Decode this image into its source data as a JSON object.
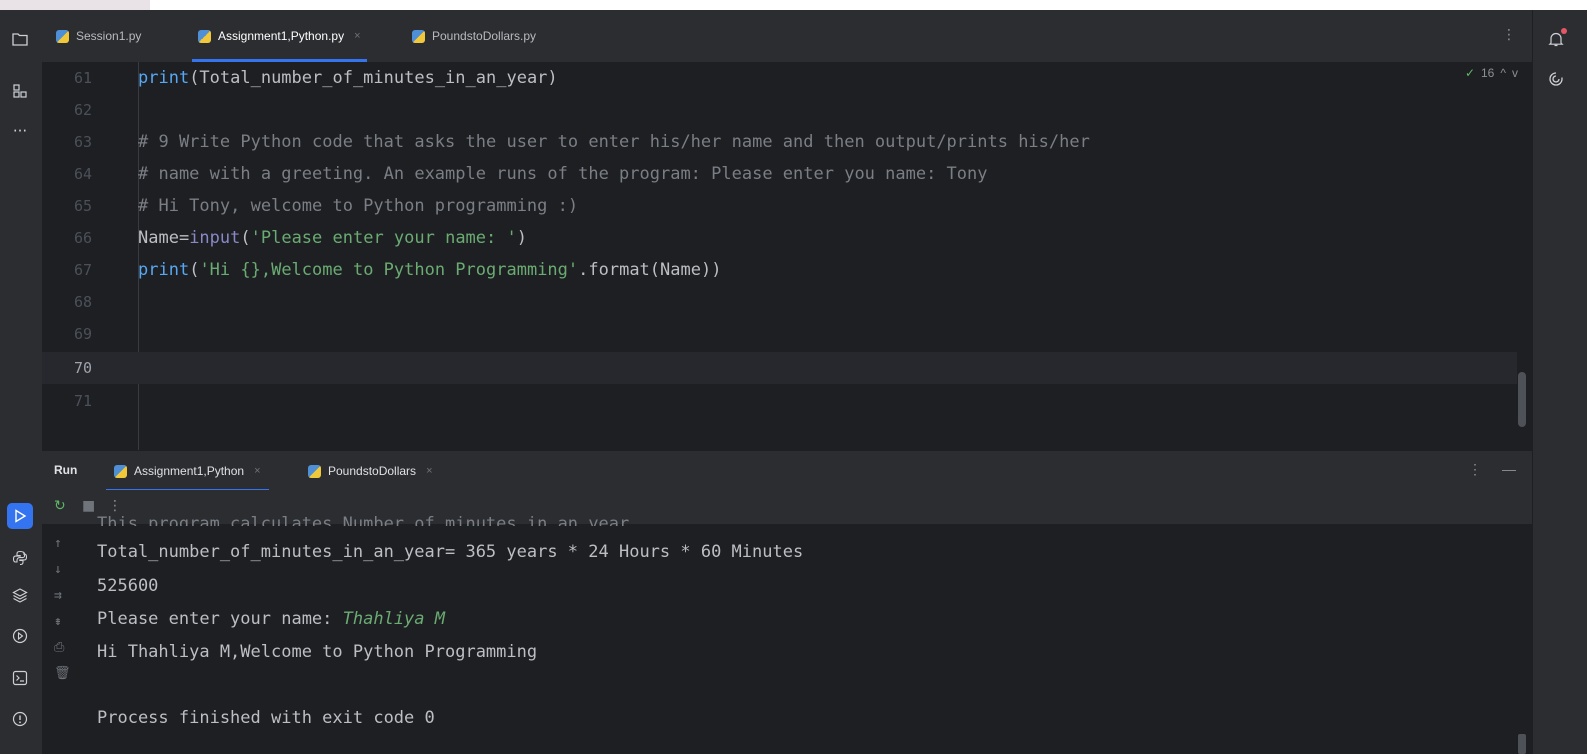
{
  "editor_tabs": [
    {
      "label": "Session1.py",
      "active": false,
      "closable": false
    },
    {
      "label": "Assignment1,Python.py",
      "active": true,
      "closable": true
    },
    {
      "label": "PoundstoDollars.py",
      "active": false,
      "closable": false
    }
  ],
  "tab_close_glyph": "×",
  "more_glyph": "⋮",
  "left_toolbar_icons": [
    "project-icon",
    "structure-icon",
    "more-icon"
  ],
  "left_bottom_icons": [
    "run-icon",
    "python-packages-icon",
    "layers-icon",
    "services-icon",
    "terminal-icon",
    "problems-icon"
  ],
  "right_toolbar_icons": [
    "notifications-icon",
    "ai-assistant-icon"
  ],
  "inspection": {
    "count": "16",
    "up": "^",
    "down": "v"
  },
  "editor": {
    "lines": [
      {
        "num": "61",
        "code": "print(Total_number_of_minutes_in_an_year)"
      },
      {
        "num": "62",
        "code": ""
      },
      {
        "num": "63",
        "code": "# 9 Write Python code that asks the user to enter his/her name and then output/prints his/her"
      },
      {
        "num": "64",
        "code": "# name with a greeting. An example runs of the program: Please enter you name: Tony"
      },
      {
        "num": "65",
        "code": "# Hi Tony, welcome to Python programming :)"
      },
      {
        "num": "66",
        "code": "Name=input('Please enter your name: ')"
      },
      {
        "num": "67",
        "code": "print('Hi {},Welcome to Python Programming'.format(Name))"
      },
      {
        "num": "68",
        "code": ""
      },
      {
        "num": "69",
        "code": ""
      },
      {
        "num": "70",
        "code": "",
        "current": true
      },
      {
        "num": "71",
        "code": ""
      }
    ],
    "tokens": {
      "l61_fn": "print",
      "l61_rest": "(Total_number_of_minutes_in_an_year)",
      "l66_var": "Name=",
      "l66_fn": "input",
      "l66_open": "(",
      "l66_str": "'Please enter your name: '",
      "l66_close": ")",
      "l67_fn": "print",
      "l67_open": "(",
      "l67_str": "'Hi {},Welcome to Python Programming'",
      "l67_rest": ".format(Name))"
    }
  },
  "run_panel": {
    "label": "Run",
    "tabs": [
      {
        "label": "Assignment1,Python",
        "active": true
      },
      {
        "label": "PoundstoDollars",
        "active": false
      }
    ],
    "controls": {
      "more": "⋮",
      "minimize": "—"
    },
    "toolbar": {
      "rerun": "↻",
      "stop": "■",
      "more": "⋮"
    }
  },
  "console": {
    "partial_line": "This_program_calculates_Number_of_minutes_in_an_year",
    "lines": [
      "Total_number_of_minutes_in_an_year= 365 years * 24 Hours * 60 Minutes",
      "525600",
      "Please enter your name: ",
      "Hi Thahliya M,Welcome to Python Programming",
      "",
      "Process finished with exit code 0"
    ],
    "user_input": "Thahliya M",
    "side_tools": [
      "↑",
      "↓",
      "⇉",
      "⇟",
      "⎙",
      "🗑"
    ]
  }
}
